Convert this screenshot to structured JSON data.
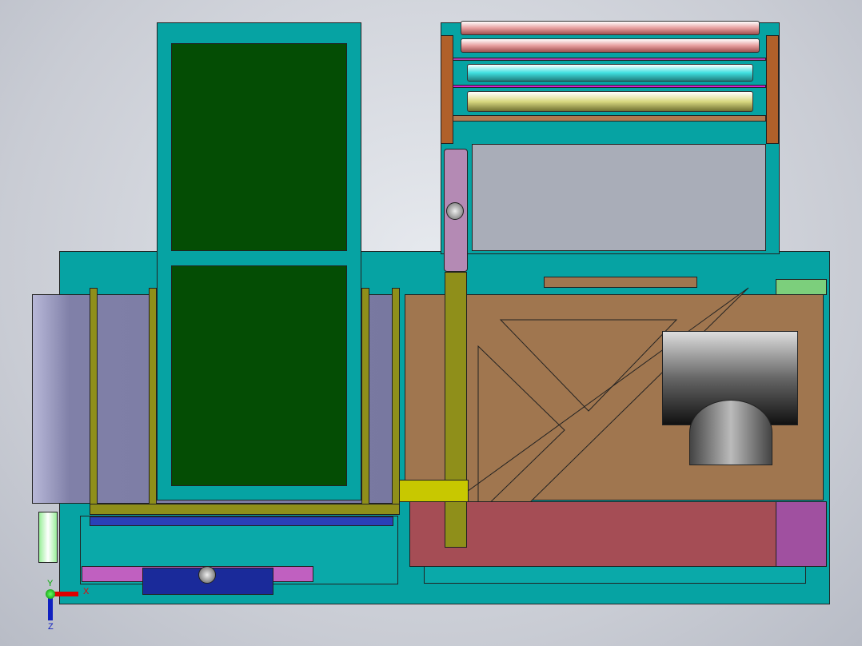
{
  "triad": {
    "x_label": "X",
    "y_label": "Y",
    "z_label": "Z"
  },
  "colors": {
    "frame": "#06a3a3",
    "panel": "#044d04",
    "plate": "#a0764f",
    "base": "#a54d55",
    "roller_frame": "#b0602a"
  }
}
